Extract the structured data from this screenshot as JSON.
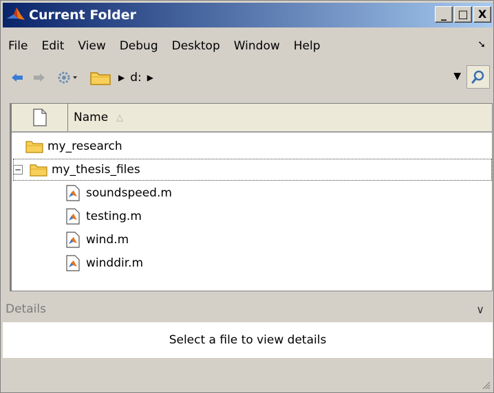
{
  "window": {
    "title": "Current Folder",
    "controls": {
      "minimize": "_",
      "maximize": "□",
      "close": "X"
    }
  },
  "menubar": {
    "items": [
      "File",
      "Edit",
      "View",
      "Debug",
      "Desktop",
      "Window",
      "Help"
    ],
    "dock_icon": "undock-icon"
  },
  "toolbar": {
    "back_icon": "back-arrow-icon",
    "forward_icon": "forward-arrow-icon",
    "settings_icon": "gear-icon",
    "folder_icon": "folder-icon",
    "path": [
      "d:"
    ],
    "search_icon": "search-icon"
  },
  "file_list": {
    "column_header": "Name",
    "sort_indicator": "△",
    "items": [
      {
        "name": "my_research",
        "type": "folder",
        "level": 0
      },
      {
        "name": "my_thesis_files",
        "type": "folder",
        "level": 0,
        "expanded": true,
        "expander": "−"
      },
      {
        "name": "soundspeed.m",
        "type": "m-file",
        "level": 1
      },
      {
        "name": "testing.m",
        "type": "m-file",
        "level": 1
      },
      {
        "name": "wind.m",
        "type": "m-file",
        "level": 1
      },
      {
        "name": "winddir.m",
        "type": "m-file",
        "level": 1
      }
    ]
  },
  "details": {
    "label": "Details",
    "chevron": "∨",
    "message": "Select a file to view details"
  },
  "colors": {
    "titlebar_start": "#0a246a",
    "titlebar_end": "#a6caf0",
    "folder": "#f7cf5a",
    "chrome": "#d4d0c8"
  }
}
